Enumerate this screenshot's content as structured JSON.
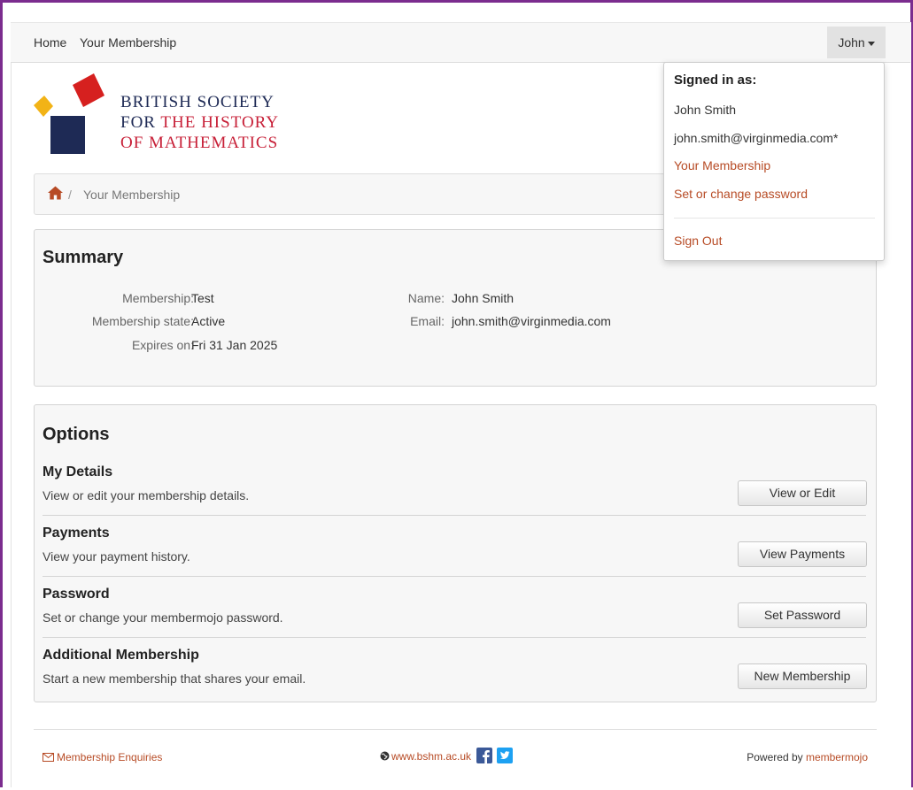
{
  "nav": {
    "home": "Home",
    "membership": "Your Membership",
    "user": "John"
  },
  "logo": {
    "line1": "BRITISH SOCIETY",
    "line2a": "FOR",
    "line2b": "THE HISTORY",
    "line3": "OF MATHEMATICS"
  },
  "breadcrumb": {
    "separator": "/",
    "current": "Your Membership"
  },
  "summary": {
    "title": "Summary",
    "membership_label": "Membership:",
    "membership_value": "Test",
    "state_label": "Membership state:",
    "state_value": "Active",
    "expires_label": "Expires on:",
    "expires_value": "Fri 31 Jan 2025",
    "name_label": "Name:",
    "name_value": "John Smith",
    "email_label": "Email:",
    "email_value": "john.smith@virginmedia.com"
  },
  "options": {
    "title": "Options",
    "items": [
      {
        "title": "My Details",
        "desc": "View or edit your membership details.",
        "button": "View or Edit"
      },
      {
        "title": "Payments",
        "desc": "View your payment history.",
        "button": "View Payments"
      },
      {
        "title": "Password",
        "desc": "Set or change your membermojo password.",
        "button": "Set Password"
      },
      {
        "title": "Additional Membership",
        "desc": "Start a new membership that shares your email.",
        "button": "New Membership"
      }
    ]
  },
  "footer": {
    "enquiries": "Membership Enquiries",
    "website": "www.bshm.ac.uk",
    "powered_by": "Powered by",
    "brand": "membermojo"
  },
  "dropdown": {
    "signed_in_as": "Signed in as:",
    "name": "John Smith",
    "email": "john.smith@virginmedia.com*",
    "your_membership": "Your Membership",
    "set_password": "Set or change password",
    "sign_out": "Sign Out"
  },
  "colors": {
    "accent": "#b74b25",
    "frame": "#7b2c8e",
    "logo_red": "#c71f37",
    "logo_navy": "#1e2a55",
    "logo_yellow": "#f2b316",
    "social_blue": "#3b5998",
    "twitter_blue": "#1da1f2"
  }
}
